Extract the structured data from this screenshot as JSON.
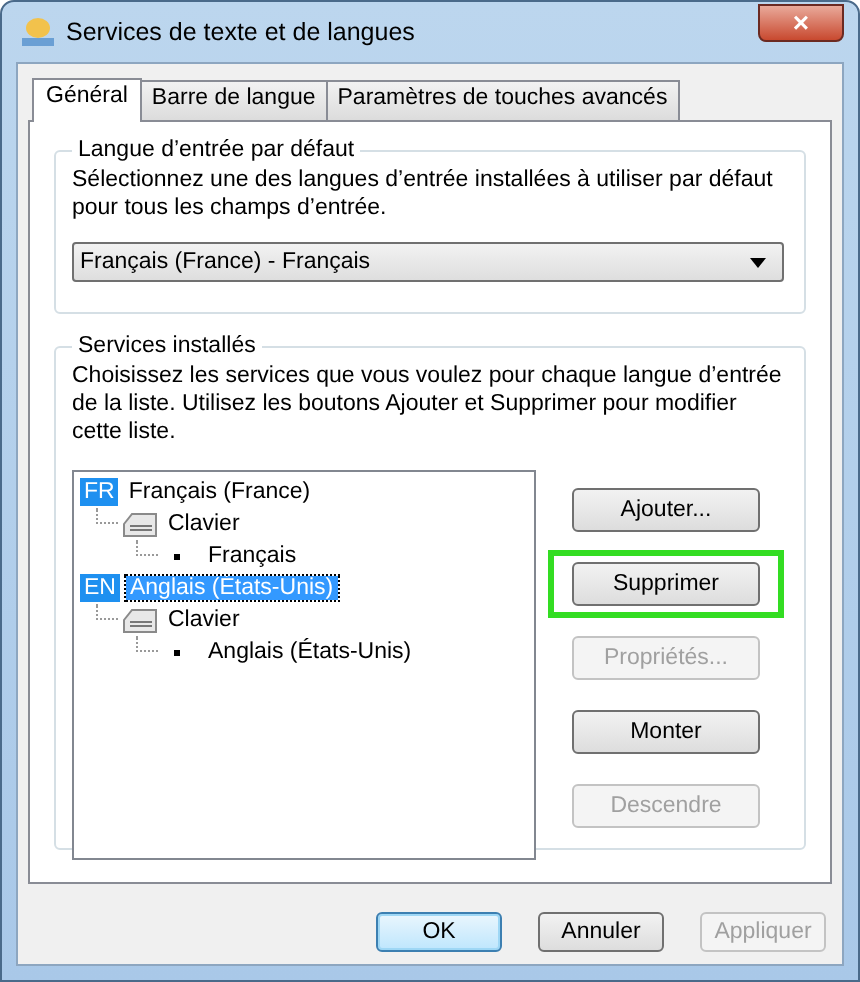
{
  "window": {
    "title": "Services de texte et de langues",
    "close": "×"
  },
  "tabs": [
    {
      "label": "Général",
      "selected": true
    },
    {
      "label": "Barre de langue",
      "selected": false
    },
    {
      "label": "Paramètres de touches avancés",
      "selected": false
    }
  ],
  "default_language": {
    "title": "Langue d’entrée par défaut",
    "description": "Sélectionnez une des langues d’entrée installées à utiliser par défaut pour tous les champs d’entrée.",
    "dropdown": {
      "value": "Français (France) - Français"
    }
  },
  "installed_services": {
    "title": "Services installés",
    "description": "Choisissez les services que vous voulez pour chaque langue d’entrée de la liste. Utilisez les boutons Ajouter et Supprimer pour modifier cette liste.",
    "tree": [
      {
        "kind": "language",
        "badge": "FR",
        "label": "Français (France)",
        "selected": false,
        "children": [
          {
            "kind": "category",
            "label": "Clavier",
            "selected": false,
            "children": [
              {
                "kind": "layout",
                "label": "Français",
                "selected": false
              }
            ]
          }
        ]
      },
      {
        "kind": "language",
        "badge": "EN",
        "label": "Anglais (États-Unis)",
        "selected": true,
        "children": [
          {
            "kind": "category",
            "label": "Clavier",
            "selected": false,
            "children": [
              {
                "kind": "layout",
                "label": "Anglais (États-Unis)",
                "selected": false
              }
            ]
          }
        ]
      }
    ],
    "buttons": [
      {
        "label": "Ajouter...",
        "disabled": false,
        "highlighted": false
      },
      {
        "label": "Supprimer",
        "disabled": false,
        "highlighted": true
      },
      {
        "label": "Propriétés...",
        "disabled": true,
        "highlighted": false
      },
      {
        "label": "Monter",
        "disabled": false,
        "highlighted": false
      },
      {
        "label": "Descendre",
        "disabled": true,
        "highlighted": false
      }
    ]
  },
  "footer_buttons": [
    {
      "label": "OK",
      "disabled": false,
      "default": true
    },
    {
      "label": "Annuler",
      "disabled": false,
      "default": false
    },
    {
      "label": "Appliquer",
      "disabled": true,
      "default": false
    }
  ]
}
